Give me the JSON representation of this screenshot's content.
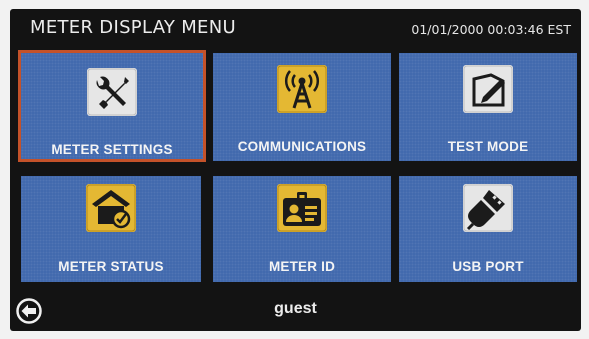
{
  "header": {
    "title": "METER DISPLAY MENU",
    "datetime": "01/01/2000 00:03:46 EST"
  },
  "tiles": [
    {
      "label": "METER SETTINGS",
      "icon": "wrench-screwdriver-icon",
      "selected": true
    },
    {
      "label": "COMMUNICATIONS",
      "icon": "antenna-tower-icon",
      "selected": false
    },
    {
      "label": "TEST MODE",
      "icon": "pencil-paper-icon",
      "selected": false
    },
    {
      "label": "METER STATUS",
      "icon": "house-check-icon",
      "selected": false
    },
    {
      "label": "METER ID",
      "icon": "id-badge-icon",
      "selected": false
    },
    {
      "label": "USB PORT",
      "icon": "usb-plug-icon",
      "selected": false
    }
  ],
  "footer": {
    "user": "guest",
    "back_icon": "back-arrow-icon"
  },
  "colors": {
    "screen_bg": "#131313",
    "tile_bg": "#3f67ad",
    "selected_border": "#c4522a",
    "icon_bg": "#e4b833"
  }
}
